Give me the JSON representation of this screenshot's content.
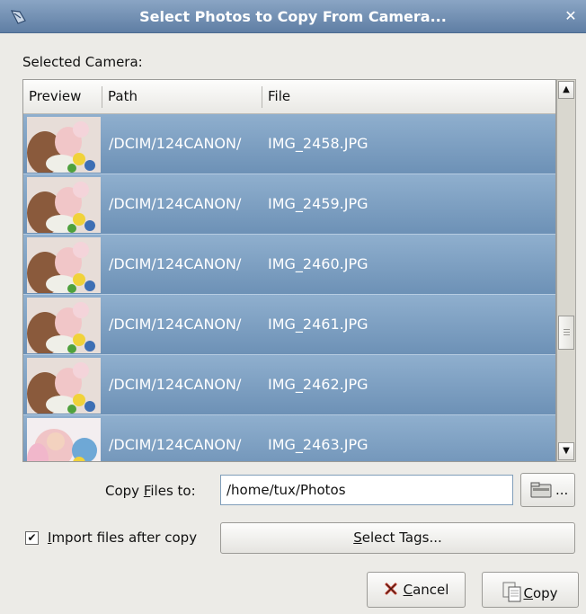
{
  "window": {
    "title": "Select Photos to Copy From Camera..."
  },
  "labels": {
    "selected_camera": "Selected Camera:",
    "copy_files_to_pre": "Copy ",
    "copy_files_to_ul": "F",
    "copy_files_to_post": "iles to:",
    "import_ul": "I",
    "import_post": "mport files after copy"
  },
  "list": {
    "columns": [
      "Preview",
      "Path",
      "File"
    ],
    "rows": [
      {
        "path": "/DCIM/124CANON/",
        "file": "IMG_2458.JPG"
      },
      {
        "path": "/DCIM/124CANON/",
        "file": "IMG_2459.JPG"
      },
      {
        "path": "/DCIM/124CANON/",
        "file": "IMG_2460.JPG"
      },
      {
        "path": "/DCIM/124CANON/",
        "file": "IMG_2461.JPG"
      },
      {
        "path": "/DCIM/124CANON/",
        "file": "IMG_2462.JPG"
      },
      {
        "path": "/DCIM/124CANON/",
        "file": "IMG_2463.JPG"
      }
    ]
  },
  "destination": {
    "value": "/home/tux/Photos"
  },
  "import_checked": true,
  "buttons": {
    "browse": "...",
    "select_tags_ul": "S",
    "select_tags_post": "elect Tags...",
    "cancel_ul": "C",
    "cancel_post": "ancel",
    "copy_ul": "C",
    "copy_post": "opy"
  },
  "icons": {
    "app": "camera-import-icon",
    "close": "close-icon",
    "browse": "folder-icon",
    "cancel": "cancel-x-icon",
    "copy": "copy-icon"
  },
  "colors": {
    "titlebar": "#6f8db1",
    "selection": "#7d9fc3",
    "background": "#ecebe7"
  }
}
